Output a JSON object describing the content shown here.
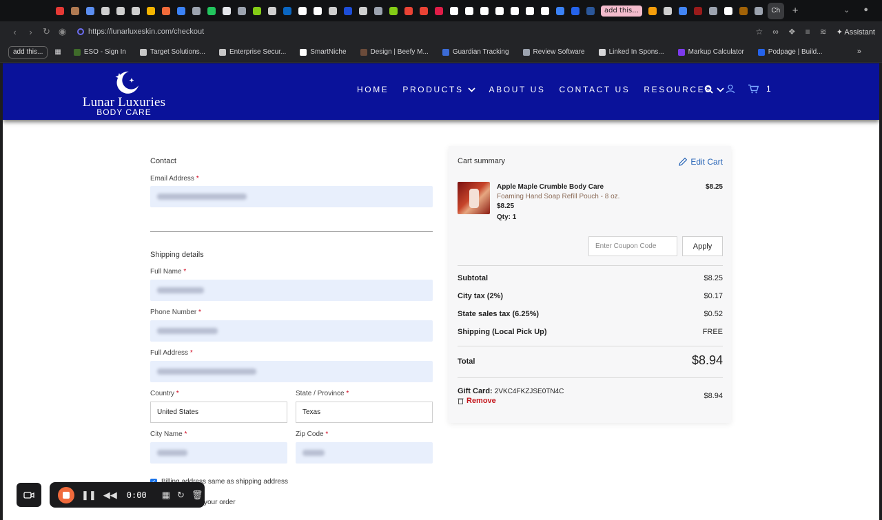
{
  "browser": {
    "tabs": [
      {
        "icon": "youtube-tab-icon",
        "color": "#e53935"
      },
      {
        "icon": "avatar-tab-icon",
        "color": "#b07a52"
      },
      {
        "icon": "check-tab-icon",
        "color": "#5b8ef0"
      },
      {
        "icon": "chatgpt-tab-icon",
        "color": "#cfcfcf"
      },
      {
        "icon": "chatgpt-tab-icon",
        "color": "#cfcfcf"
      },
      {
        "icon": "chatgpt-tab-icon",
        "color": "#cfcfcf"
      },
      {
        "icon": "drive-tab-icon",
        "color": "#f4b400"
      },
      {
        "icon": "orange-tab-icon",
        "color": "#f26b3a"
      },
      {
        "icon": "blue-tab-icon",
        "color": "#3b82f6"
      },
      {
        "icon": "bars-tab-icon",
        "color": "#9ca3af"
      },
      {
        "icon": "green-tab-icon",
        "color": "#22c55e"
      },
      {
        "icon": "doc-tab-icon",
        "color": "#e5e7eb"
      },
      {
        "icon": "bars-tab-icon",
        "color": "#9ca3af"
      },
      {
        "icon": "d-tab-icon",
        "color": "#84cc16"
      },
      {
        "icon": "chatgpt-tab-icon",
        "color": "#cfcfcf"
      },
      {
        "icon": "linkedin-tab-icon",
        "color": "#0a66c2"
      },
      {
        "icon": "google-tab-icon",
        "color": "#ffffff"
      },
      {
        "icon": "google-tab-icon",
        "color": "#ffffff"
      },
      {
        "icon": "chatgpt-tab-icon",
        "color": "#cfcfcf"
      },
      {
        "icon": "blue-tab-icon",
        "color": "#1d4ed8"
      },
      {
        "icon": "star-tab-icon",
        "color": "#cfcfcf"
      },
      {
        "icon": "bars-tab-icon",
        "color": "#9ca3af"
      },
      {
        "icon": "d-tab-icon",
        "color": "#84cc16"
      },
      {
        "icon": "gmail-tab-icon",
        "color": "#ea4335"
      },
      {
        "icon": "gmail-tab-icon",
        "color": "#ea4335"
      },
      {
        "icon": "sk-tab-icon",
        "color": "#e11d48"
      },
      {
        "icon": "a-tab-icon",
        "color": "#ffffff"
      },
      {
        "icon": "a-tab-icon",
        "color": "#ffffff"
      },
      {
        "icon": "a-tab-icon",
        "color": "#ffffff"
      },
      {
        "icon": "a-tab-icon",
        "color": "#ffffff"
      },
      {
        "icon": "a-tab-icon",
        "color": "#ffffff"
      },
      {
        "icon": "a-tab-icon",
        "color": "#ffffff"
      },
      {
        "icon": "a-tab-icon",
        "color": "#ffffff"
      },
      {
        "icon": "blue-tab-icon",
        "color": "#3b82f6"
      },
      {
        "icon": "blue-tab-icon",
        "color": "#2563eb"
      },
      {
        "icon": "word-tab-icon",
        "color": "#2b579a"
      }
    ],
    "special_tab": "add this...",
    "tabs_after": [
      {
        "icon": "orange-tab-icon",
        "color": "#f59e0b"
      },
      {
        "icon": "star-tab-icon",
        "color": "#cfcfcf"
      },
      {
        "icon": "docs-tab-icon",
        "color": "#4285f4"
      },
      {
        "icon": "red-tab-icon",
        "color": "#991b1b"
      },
      {
        "icon": "bars-tab-icon",
        "color": "#9ca3af"
      },
      {
        "icon": "google-tab-icon",
        "color": "#ffffff"
      },
      {
        "icon": "image-tab-icon",
        "color": "#a16207"
      },
      {
        "icon": "cube-tab-icon",
        "color": "#9ca3af"
      }
    ],
    "active_tab": "Ch",
    "url": "https://lunarluxeskin.com/checkout",
    "assistant": "Assistant",
    "bookmarks_chip": "add this...",
    "bookmarks": [
      {
        "label": "ESO - Sign In",
        "color": "#3f6b2a"
      },
      {
        "label": "Target Solutions...",
        "color": "#c7c7c7"
      },
      {
        "label": "Enterprise Secur...",
        "color": "#c7c7c7"
      },
      {
        "label": "SmartNiche",
        "color": "#ffffff"
      },
      {
        "label": "Design | Beefy M...",
        "color": "#6b4b3a"
      },
      {
        "label": "Guardian Tracking",
        "color": "#3b6bd6"
      },
      {
        "label": "Review Software",
        "color": "#9ca3af"
      },
      {
        "label": "Linked In Spons...",
        "color": "#d6d6d8"
      },
      {
        "label": "Markup Calculator",
        "color": "#7c3aed"
      },
      {
        "label": "Podpage | Build...",
        "color": "#2563eb"
      }
    ]
  },
  "site": {
    "logo_name": "Lunar Luxuries",
    "logo_sub": "BODY CARE",
    "nav": [
      {
        "label": "HOME",
        "dropdown": false
      },
      {
        "label": "PRODUCTS",
        "dropdown": true
      },
      {
        "label": "ABOUT US",
        "dropdown": false
      },
      {
        "label": "CONTACT US",
        "dropdown": false
      },
      {
        "label": "RESOURCES",
        "dropdown": true
      }
    ],
    "cart_count": "1",
    "header_color": "#0a129a"
  },
  "form": {
    "contact_title": "Contact",
    "email_label": "Email Address",
    "shipping_title": "Shipping details",
    "full_name_label": "Full Name",
    "phone_label": "Phone Number",
    "address_label": "Full Address",
    "country_label": "Country",
    "country_value": "United States",
    "state_label": "State / Province",
    "state_value": "Texas",
    "city_label": "City Name",
    "zip_label": "Zip Code",
    "required_mark": "*",
    "billing_same": "Billing address same as shipping address",
    "partial_text": "your order"
  },
  "summary": {
    "title": "Cart summary",
    "edit_cart": "Edit Cart",
    "product_name": "Apple Maple Crumble Body Care",
    "product_variant": "Foaming Hand Soap Refill Pouch - 8 oz.",
    "product_price": "$8.25",
    "product_qty": "Qty: 1",
    "line_total": "$8.25",
    "coupon_placeholder": "Enter Coupon Code",
    "apply": "Apply",
    "rows": [
      {
        "label": "Subtotal",
        "value": "$8.25"
      },
      {
        "label": "City tax (2%)",
        "value": "$0.17"
      },
      {
        "label": "State sales tax (6.25%)",
        "value": "$0.52"
      },
      {
        "label": "Shipping (Local Pick Up)",
        "value": "FREE"
      }
    ],
    "total_label": "Total",
    "total_value": "$8.94",
    "gift_label": "Gift Card:",
    "gift_code": "2VKC4FKZJSE0TN4C",
    "gift_value": "$8.94",
    "remove": "Remove"
  },
  "recorder": {
    "time": "0:00"
  }
}
